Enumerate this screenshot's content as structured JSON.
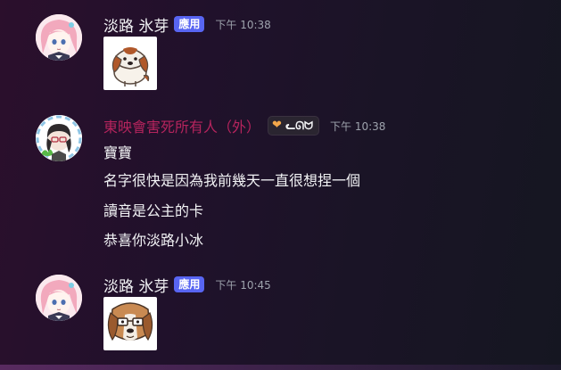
{
  "messages": [
    {
      "user": "淡路 氷芽",
      "badge": "應用",
      "time": "下午 10:38",
      "sticker": "beagle-sticker-sitting"
    },
    {
      "user": "東映會害死所有人（外）",
      "tag": "ᓚᘏᗢ",
      "tag_icon": "heart-icon",
      "time": "下午 10:38",
      "lines": [
        "寶寶",
        "名字很快是因為我前幾天一直很想捏一個",
        "讀音是公主的卡",
        "恭喜你淡路小冰"
      ]
    },
    {
      "user": "淡路 氷芽",
      "badge": "應用",
      "time": "下午 10:45",
      "sticker": "beagle-sticker-glasses"
    }
  ],
  "colors": {
    "app_badge": "#5865f2",
    "pink_username": "#b5245d",
    "timestamp": "#9ea3ad"
  }
}
